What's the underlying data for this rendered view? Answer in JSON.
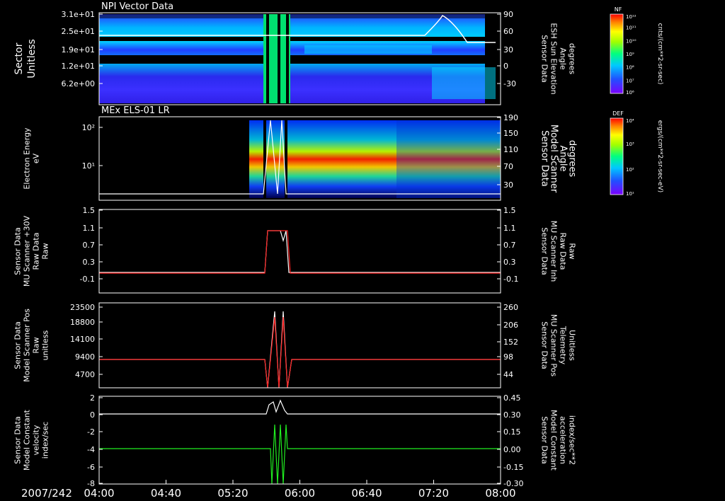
{
  "date_label": "2007/242",
  "x_ticks": [
    "04:00",
    "04:40",
    "05:20",
    "06:00",
    "06:40",
    "07:20",
    "08:00"
  ],
  "panels": [
    {
      "id": "npi",
      "title": "NPI Vector Data",
      "left_label": [
        "Sector",
        "Unitless"
      ],
      "left_ticks": [
        "3.1e+01",
        "2.5e+01",
        "1.9e+01",
        "1.2e+01",
        "6.2e+00"
      ],
      "right_label": [
        "Sensor Data",
        "ESH Sun Elevation",
        "Angle",
        "degrees"
      ],
      "right_ticks": [
        "90",
        "60",
        "30",
        "0",
        "-30"
      ],
      "colorbar": {
        "name": "NF",
        "top": "10¹²",
        "ticks": [
          "10¹¹",
          "10¹⁰",
          "10⁹",
          "10⁸",
          "10⁷"
        ],
        "bottom": "10⁶",
        "units": "cnts/(cm**2-sr-sec)"
      }
    },
    {
      "id": "els",
      "title": "MEx ELS-01 LR",
      "left_label": [
        "Electron Energy",
        "eV"
      ],
      "left_ticks": [
        "10²",
        "10¹"
      ],
      "right_label": [
        "Sensor Data",
        "Model Scanner",
        "Angle",
        "degrees"
      ],
      "right_ticks": [
        "190",
        "150",
        "110",
        "70",
        "30"
      ],
      "colorbar": {
        "name": "DEF",
        "top": "10⁴",
        "ticks": [
          "10³",
          "10²"
        ],
        "bottom": "10¹",
        "units": "ergs/(cm**2-sr-sec-eV)"
      }
    },
    {
      "id": "mu_raw",
      "left_label": [
        "Sensor Data",
        "MU Scanner +30V",
        "Raw Data",
        "Raw"
      ],
      "left_ticks": [
        "1.5",
        "1.1",
        "0.7",
        "0.3",
        "-0.1"
      ],
      "right_label": [
        "Sensor Data",
        "MU Scanner Inh",
        "Raw Data",
        "Raw"
      ],
      "right_ticks": [
        "1.5",
        "1.1",
        "0.7",
        "0.3",
        "-0.1"
      ]
    },
    {
      "id": "scanner_pos",
      "left_label": [
        "Sensor Data",
        "Model Scanner Pos",
        "Raw",
        "unitless"
      ],
      "left_ticks": [
        "23500",
        "18800",
        "14100",
        "9400",
        "4700"
      ],
      "right_label": [
        "Sensor Data",
        "MU Scanner Pos",
        "Telemetry",
        "Unitless"
      ],
      "right_ticks": [
        "260",
        "206",
        "152",
        "98",
        "44"
      ]
    },
    {
      "id": "velocity",
      "left_label": [
        "Sensor Data",
        "Model Constant",
        "velocity",
        "index/sec"
      ],
      "left_ticks": [
        "2",
        "0",
        "-2",
        "-4",
        "-6",
        "-8"
      ],
      "right_label": [
        "Sensor Data",
        "Model Constant",
        "acceleration",
        "index/sec**2"
      ],
      "right_ticks": [
        "0.45",
        "0.30",
        "0.15",
        "0.00",
        "-0.15",
        "-0.30"
      ]
    }
  ],
  "colors": {
    "white": "#ffffff",
    "red": "#ff2020",
    "green": "#20ee20",
    "background": "#000000"
  },
  "chart_data": [
    {
      "type": "heatmap",
      "title": "NPI Vector Data",
      "ylabel": "Sector Unitless",
      "y_ticks": [
        31,
        25,
        19,
        12,
        6.2
      ],
      "overlay_series": [
        {
          "name": "ESH Sun Elevation Angle (degrees)",
          "x": [
            "04:00",
            "05:18",
            "05:20",
            "06:00",
            "07:05",
            "07:20",
            "07:35",
            "08:00"
          ],
          "values": [
            48,
            48,
            48,
            48,
            48,
            85,
            40,
            40
          ]
        }
      ]
    },
    {
      "type": "heatmap",
      "title": "MEx ELS-01 LR",
      "ylabel": "Electron Energy eV",
      "yscale": "log",
      "overlay_series": [
        {
          "name": "Model Scanner Angle (degrees)",
          "x": [
            "04:00",
            "05:24",
            "05:30",
            "06:00",
            "08:00"
          ],
          "values": [
            20,
            20,
            190,
            20,
            20
          ]
        }
      ]
    },
    {
      "type": "line",
      "ylabel": "MU Scanner +30V Raw Data",
      "ylim": [
        -0.3,
        1.5
      ],
      "series": [
        {
          "name": "MU Scanner Inh Raw Data",
          "x": [
            "04:00",
            "05:24",
            "05:27",
            "05:40",
            "05:41",
            "05:44",
            "08:00"
          ],
          "values": [
            0,
            0,
            1,
            1,
            0.8,
            1,
            0
          ]
        },
        {
          "name": "MU Scanner +30V Raw Data",
          "x": [
            "04:00",
            "05:24",
            "05:27",
            "05:44",
            "08:00"
          ],
          "values": [
            0,
            0,
            1,
            1,
            0
          ]
        }
      ]
    },
    {
      "type": "line",
      "ylabel": "Model Scanner Pos Raw unitless",
      "ylim": [
        0,
        23500
      ],
      "series": [
        {
          "name": "Model Scanner Pos",
          "x": [
            "04:00",
            "05:24",
            "05:27",
            "05:32",
            "05:36",
            "05:41",
            "05:44",
            "08:00"
          ],
          "values": [
            7700,
            7700,
            0,
            22500,
            0,
            22500,
            7700,
            7700
          ]
        },
        {
          "name": "MU Scanner Pos Telemetry",
          "x": [
            "04:00",
            "05:24",
            "05:27",
            "05:32",
            "05:36",
            "05:41",
            "05:44",
            "08:00"
          ],
          "values": [
            85,
            85,
            0,
            250,
            0,
            250,
            85,
            85
          ]
        }
      ]
    },
    {
      "type": "line",
      "ylabel": "Model Constant velocity index/sec",
      "ylim": [
        -8,
        2
      ],
      "series": [
        {
          "name": "velocity",
          "x": [
            "04:00",
            "05:24",
            "05:27",
            "05:30",
            "05:36",
            "05:40",
            "05:44",
            "08:00"
          ],
          "values": [
            0,
            0,
            1,
            0.3,
            1,
            0.5,
            0,
            0
          ]
        },
        {
          "name": "acceleration",
          "x": [
            "04:00",
            "05:26",
            "05:30",
            "05:34",
            "05:38",
            "05:42",
            "08:00"
          ],
          "values": [
            0,
            -0.3,
            0,
            -0.3,
            0,
            -0.3,
            0
          ]
        }
      ]
    }
  ]
}
